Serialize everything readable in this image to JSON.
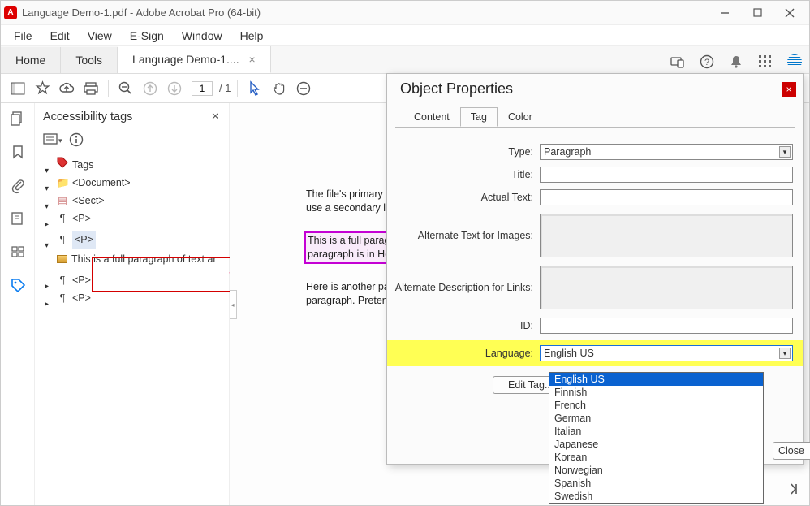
{
  "window": {
    "title": "Language Demo-1.pdf - Adobe Acrobat Pro (64-bit)"
  },
  "menu": [
    "File",
    "Edit",
    "View",
    "E-Sign",
    "Window",
    "Help"
  ],
  "tabs": {
    "home": "Home",
    "tools": "Tools",
    "doc": "Language Demo-1...."
  },
  "toolbar": {
    "page_current": "1",
    "page_total": "/ 1"
  },
  "panel": {
    "title": "Accessibility tags",
    "root": "Tags",
    "doc": "<Document>",
    "sect": "<Sect>",
    "p": "<P>",
    "text_leaf": "This is a full paragraph of text ar"
  },
  "document_text": {
    "p1a": "The file's primary la",
    "p1b": "use a secondary la",
    "p2a": "This is a full paragr",
    "p2b": "paragraph is in Heb",
    "p3a": "Here is another par",
    "p3b": "paragraph. Pretend"
  },
  "dialog": {
    "title": "Object Properties",
    "tabs": [
      "Content",
      "Tag",
      "Color"
    ],
    "labels": {
      "type": "Type:",
      "title": "Title:",
      "actual": "Actual Text:",
      "alt_img": "Alternate Text for Images:",
      "alt_link": "Alternate Description for Links:",
      "id": "ID:",
      "language": "Language:"
    },
    "type_value": "Paragraph",
    "language_value": "English US",
    "edit_btn": "Edit Tag...",
    "close_btn": "Close",
    "lang_options": [
      "English US",
      "Finnish",
      "French",
      "German",
      "Italian",
      "Japanese",
      "Korean",
      "Norwegian",
      "Spanish",
      "Swedish"
    ]
  }
}
